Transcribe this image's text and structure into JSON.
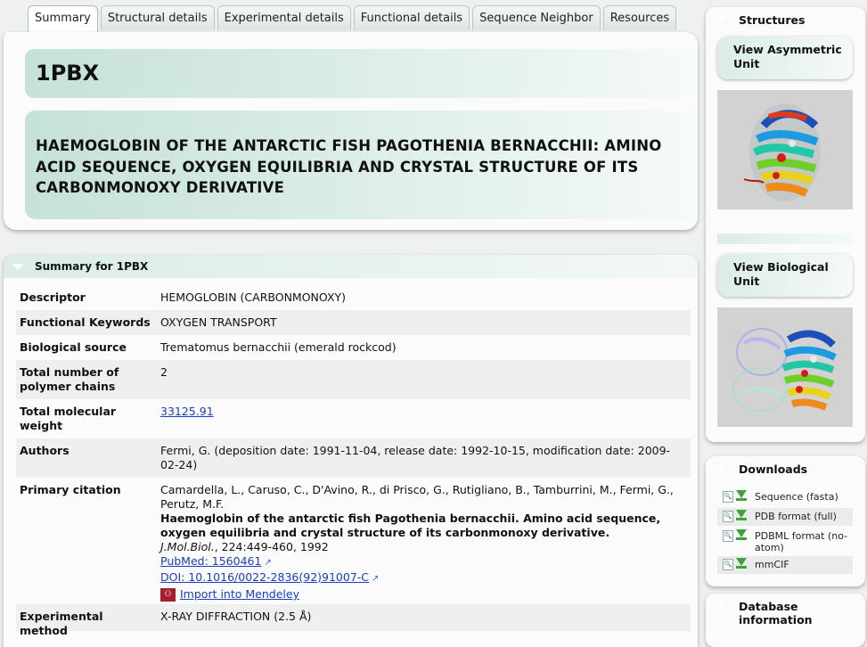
{
  "tabs": [
    {
      "label": "Summary",
      "active": true
    },
    {
      "label": "Structural details"
    },
    {
      "label": "Experimental details"
    },
    {
      "label": "Functional details"
    },
    {
      "label": "Sequence Neighbor"
    },
    {
      "label": "Resources"
    }
  ],
  "entry": {
    "id": "1PBX",
    "title": "HAEMOGLOBIN OF THE ANTARCTIC FISH PAGOTHENIA BERNACCHII: AMINO ACID SEQUENCE, OXYGEN EQUILIBRIA AND CRYSTAL STRUCTURE OF ITS CARBONMONOXY DERIVATIVE"
  },
  "summary": {
    "heading": "Summary for 1PBX",
    "descriptor_label": "Descriptor",
    "descriptor": "HEMOGLOBIN (CARBONMONOXY)",
    "keywords_label": "Functional Keywords",
    "keywords": "OXYGEN TRANSPORT",
    "source_label": "Biological source",
    "source": "Trematomus bernacchii (emerald rockcod)",
    "chains_label": "Total number of polymer chains",
    "chains": "2",
    "weight_label": "Total molecular weight",
    "weight": "33125.91",
    "authors_label": "Authors",
    "authors": "Fermi, G. (deposition date: 1991-11-04, release date: 1992-10-15, modification date: 2009-02-24)",
    "citation_label": "Primary citation",
    "citation_authors": "Camardella, L., Caruso, C., D'Avino, R., di Prisco, G., Rutigliano, B., Tamburrini, M., Fermi, G., Perutz, M.F.",
    "citation_title": "Haemoglobin of the antarctic fish Pagothenia bernacchii. Amino acid sequence, oxygen equilibria and crystal structure of its carbonmonoxy derivative.",
    "citation_journal": "J.Mol.Biol.",
    "citation_ref": ", 224:449-460, 1992",
    "pubmed": "PubMed: 1560461",
    "doi": "DOI: 10.1016/0022-2836(92)91007-C",
    "mendeley": "Import into Mendeley",
    "method_label": "Experimental method",
    "method": "X-RAY DIFFRACTION (2.5 Å)"
  },
  "sidebar": {
    "structures_title": "Structures",
    "asym_button": "View Asymmetric Unit",
    "bio_button": "View Biological Unit",
    "downloads_title": "Downloads",
    "downloads": [
      {
        "label": "Sequence (fasta)"
      },
      {
        "label": "PDB format (full)"
      },
      {
        "label": "PDBML format (no-atom)"
      },
      {
        "label": "mmCIF"
      }
    ],
    "database_title": "Database information"
  },
  "colors": {
    "panel_header": "#dbece6",
    "link": "#1a3ebd",
    "download_arrow": "#3ea33a",
    "mendeley": "#a51f2f"
  },
  "icons": {
    "collapse": "triangle-down-icon",
    "external": "external-link-icon",
    "download": "download-arrow-icon",
    "view": "magnifier-icon",
    "mendeley": "mendeley-icon"
  }
}
